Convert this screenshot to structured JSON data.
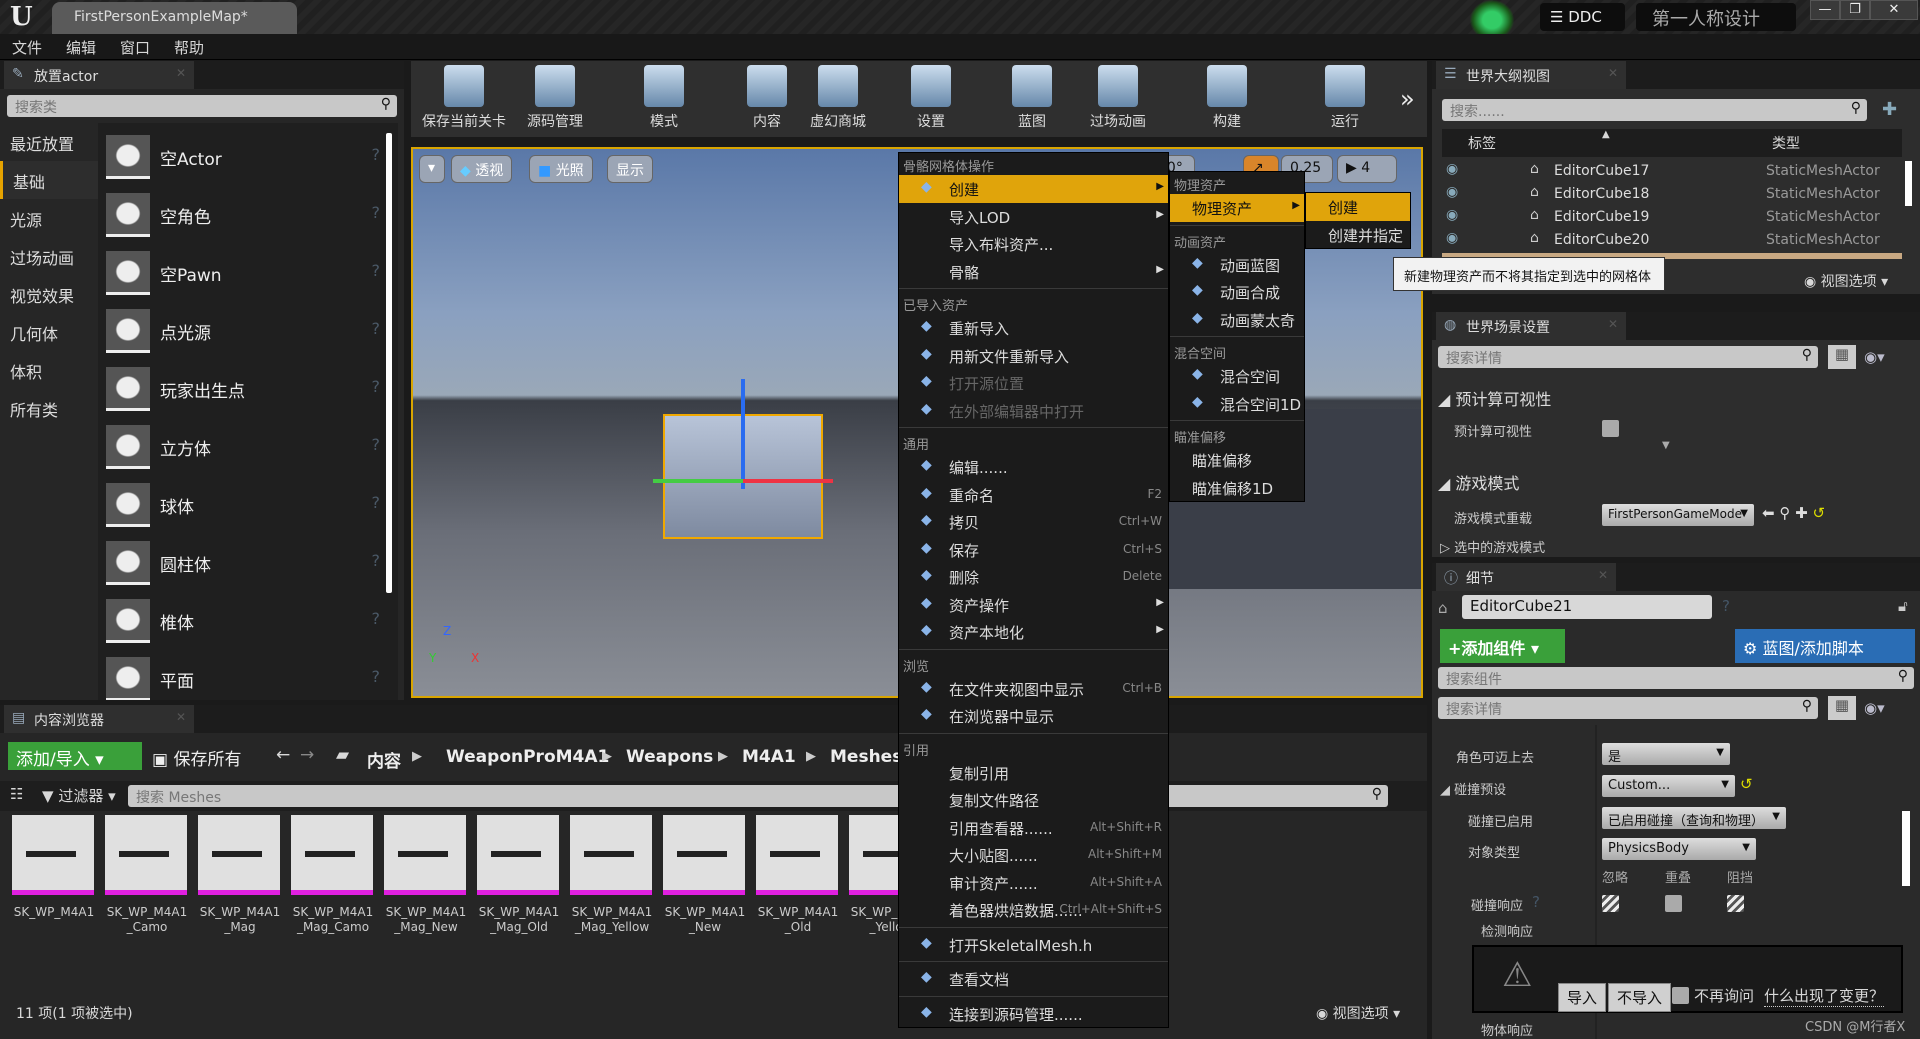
{
  "window": {
    "logo": "U",
    "map_tab": "FirstPersonExampleMap*",
    "ddc": "DDC",
    "project": "第一人称设计",
    "minimize": "—",
    "maximize": "❐",
    "close": "✕"
  },
  "menubar": [
    "文件",
    "编辑",
    "窗口",
    "帮助"
  ],
  "place_actors": {
    "tab": "放置actor",
    "search_placeholder": "搜索类",
    "categories": [
      "最近放置",
      "基础",
      "光源",
      "过场动画",
      "视觉效果",
      "几何体",
      "体积",
      "所有类"
    ],
    "selected_category": "基础",
    "items": [
      "空Actor",
      "空角色",
      "空Pawn",
      "点光源",
      "玩家出生点",
      "立方体",
      "球体",
      "圆柱体",
      "椎体",
      "平面"
    ]
  },
  "toolbar": [
    "保存当前关卡",
    "源码管理",
    "模式",
    "内容",
    "虚幻商城",
    "设置",
    "蓝图",
    "过场动画",
    "构建",
    "运行"
  ],
  "viewport": {
    "view_menu": "▾",
    "perspective": "透视",
    "lit": "光照",
    "show": "显示",
    "rot_snap": "10°",
    "scale_snap": "0.25",
    "camera_speed": "4",
    "axis_x": "X",
    "axis_y": "Y",
    "axis_z": "Z"
  },
  "content_browser": {
    "tab": "内容浏览器",
    "add_import": "添加/导入",
    "save_all": "保存所有",
    "path": [
      "内容",
      "WeaponProM4A1",
      "Weapons",
      "M4A1",
      "Meshes"
    ],
    "filters": "过滤器",
    "search_placeholder": "搜索 Meshes",
    "assets": [
      "SK_WP_M4A1",
      "SK_WP_M4A1_Camo",
      "SK_WP_M4A1_Mag",
      "SK_WP_M4A1_Mag_Camo",
      "SK_WP_M4A1_Mag_New",
      "SK_WP_M4A1_Mag_Old",
      "SK_WP_M4A1_Mag_Yellow",
      "SK_WP_M4A1_New",
      "SK_WP_M4A1_Old",
      "SK_WP_M4A1_Yellow"
    ],
    "status": "11 项(1 项被选中)",
    "view_options": "视图选项"
  },
  "context_menu": {
    "sections": [
      {
        "header": "骨骼网格体操作",
        "items": [
          {
            "label": "创建",
            "icon": "create-icon",
            "submenu": true,
            "highlighted": true
          },
          {
            "label": "导入LOD",
            "submenu": true
          },
          {
            "label": "导入布料资产..."
          },
          {
            "label": "骨骼",
            "submenu": true
          }
        ]
      },
      {
        "header": "已导入资产",
        "items": [
          {
            "label": "重新导入",
            "icon": "reimport-icon"
          },
          {
            "label": "用新文件重新导入",
            "icon": "reimport-icon"
          },
          {
            "label": "打开源位置",
            "icon": "folder-icon",
            "disabled": true
          },
          {
            "label": "在外部编辑器中打开",
            "icon": "external-icon",
            "disabled": true
          }
        ]
      },
      {
        "header": "通用",
        "items": [
          {
            "label": "编辑......",
            "icon": "edit-icon"
          },
          {
            "label": "重命名",
            "icon": "rename-icon",
            "shortcut": "F2"
          },
          {
            "label": "拷贝",
            "icon": "copy-icon",
            "shortcut": "Ctrl+W"
          },
          {
            "label": "保存",
            "icon": "save-icon",
            "shortcut": "Ctrl+S"
          },
          {
            "label": "删除",
            "icon": "delete-icon",
            "shortcut": "Delete"
          },
          {
            "label": "资产操作",
            "icon": "wrench-icon",
            "submenu": true
          },
          {
            "label": "资产本地化",
            "icon": "globe-icon",
            "submenu": true
          }
        ]
      },
      {
        "header": "浏览",
        "items": [
          {
            "label": "在文件夹视图中显示",
            "icon": "search-icon",
            "shortcut": "Ctrl+B"
          },
          {
            "label": "在浏览器中显示",
            "icon": "search-icon"
          }
        ]
      },
      {
        "header": "引用",
        "items": [
          {
            "label": "复制引用"
          },
          {
            "label": "复制文件路径"
          },
          {
            "label": "引用查看器......",
            "shortcut": "Alt+Shift+R"
          },
          {
            "label": "大小贴图......",
            "shortcut": "Alt+Shift+M"
          },
          {
            "label": "审计资产......",
            "shortcut": "Alt+Shift+A"
          },
          {
            "label": "着色器烘焙数据......",
            "shortcut": "Ctrl+Alt+Shift+S"
          }
        ]
      },
      {
        "header": "",
        "items": [
          {
            "label": "打开SkeletalMesh.h",
            "icon": "code-icon"
          }
        ]
      },
      {
        "header": "",
        "items": [
          {
            "label": "查看文档",
            "icon": "help-icon"
          }
        ]
      },
      {
        "header": "",
        "items": [
          {
            "label": "连接到源码管理......",
            "icon": "source-control-icon"
          }
        ]
      }
    ]
  },
  "create_submenu": {
    "sections": [
      {
        "header": "物理资产",
        "items": [
          {
            "label": "物理资产",
            "submenu": true,
            "highlighted": true
          }
        ]
      },
      {
        "header": "动画资产",
        "items": [
          {
            "label": "动画蓝图",
            "icon": "anim-blueprint-icon"
          },
          {
            "label": "动画合成",
            "icon": "anim-montage-icon"
          },
          {
            "label": "动画蒙太奇",
            "icon": "anim-montage-icon"
          }
        ]
      },
      {
        "header": "混合空间",
        "items": [
          {
            "label": "混合空间",
            "icon": "blendspace-icon"
          },
          {
            "label": "混合空间1D",
            "icon": "blendspace-icon"
          }
        ]
      },
      {
        "header": "瞄准偏移",
        "items": [
          {
            "label": "瞄准偏移"
          },
          {
            "label": "瞄准偏移1D"
          }
        ]
      }
    ]
  },
  "physics_submenu": [
    "创建",
    "创建并指定"
  ],
  "tooltip": "新建物理资产而不将其指定到选中的网格体",
  "outliner": {
    "tab": "世界大纲视图",
    "search_placeholder": "搜索......",
    "col_label": "标签",
    "col_type": "类型",
    "rows": [
      {
        "name": "EditorCube17",
        "type": "StaticMeshActor"
      },
      {
        "name": "EditorCube18",
        "type": "StaticMeshActor"
      },
      {
        "name": "EditorCube19",
        "type": "StaticMeshActor"
      },
      {
        "name": "EditorCube20",
        "type": "StaticMeshActor"
      }
    ],
    "view_options": "视图选项"
  },
  "world_settings": {
    "tab": "世界场景设置",
    "search_placeholder": "搜索详情",
    "precomputed": "预计算可视性",
    "precomputed_prop": "预计算可视性",
    "game_mode": "游戏模式",
    "game_mode_override": "游戏模式重载",
    "game_mode_value": "FirstPersonGameMode",
    "selected_game_mode": "选中的游戏模式"
  },
  "details": {
    "tab": "细节",
    "actor_name": "EditorCube21",
    "add_component": "+添加组件",
    "blueprint_script": "蓝图/添加脚本",
    "search_components": "搜索组件",
    "search_details": "搜索详情",
    "can_step_up": "角色可迈上去",
    "can_step_up_value": "是",
    "collision_preset": "碰撞预设",
    "collision_preset_value": "Custom...",
    "collision_enabled": "碰撞已启用",
    "collision_enabled_value": "已启用碰撞（查询和物理）",
    "object_type": "对象类型",
    "object_type_value": "PhysicsBody",
    "col_ignore": "忽略",
    "col_overlap": "重叠",
    "col_block": "阻挡",
    "collision_responses": "碰撞响应",
    "trace_responses": "检测响应",
    "object_responses": "物体响应"
  },
  "notification": {
    "import": "导入",
    "dont_import": "不导入",
    "dont_ask": "不再询问",
    "what_changed": "什么出现了变更？"
  },
  "watermark": "CSDN @M行者X"
}
